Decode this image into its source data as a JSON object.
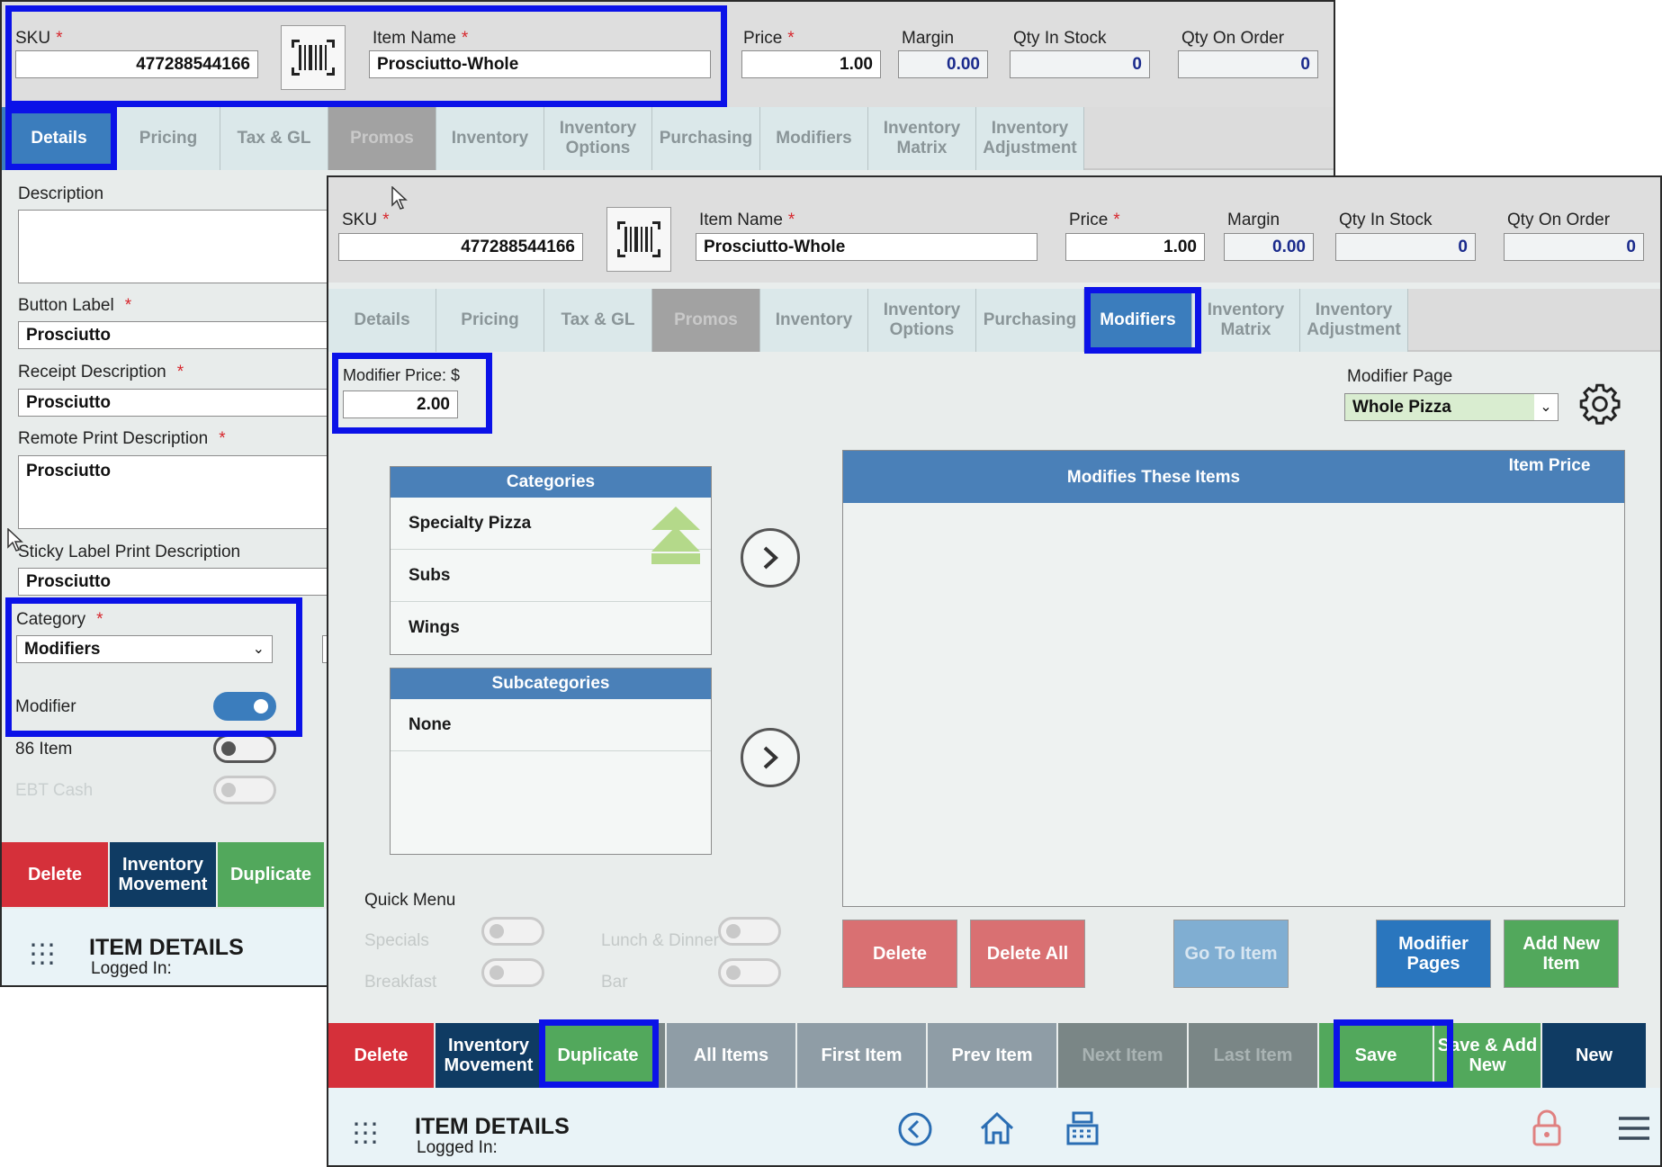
{
  "fields": {
    "sku_label": "SKU",
    "sku_value": "477288544166",
    "item_name_label": "Item Name",
    "item_name_value": "Prosciutto-Whole",
    "price_label": "Price",
    "price_value": "1.00",
    "margin_label": "Margin",
    "margin_value": "0.00",
    "qty_in_stock_label": "Qty In Stock",
    "qty_in_stock_value": "0",
    "qty_on_order_label": "Qty On Order",
    "qty_on_order_value": "0",
    "required_mark": "*"
  },
  "tabs": [
    {
      "label": "Details"
    },
    {
      "label": "Pricing"
    },
    {
      "label": "Tax & GL"
    },
    {
      "label": "Promos"
    },
    {
      "label": "Inventory"
    },
    {
      "label": "Inventory Options"
    },
    {
      "label": "Purchasing"
    },
    {
      "label": "Modifiers"
    },
    {
      "label": "Inventory Matrix"
    },
    {
      "label": "Inventory Adjustment"
    }
  ],
  "details": {
    "description_label": "Description",
    "description_value": "",
    "button_label_label": "Button Label",
    "button_label_value": "Prosciutto",
    "receipt_label": "Receipt Description",
    "receipt_value": "Prosciutto",
    "remote_label": "Remote Print Description",
    "remote_value": "Prosciutto",
    "sticky_label": "Sticky Label Print Description",
    "sticky_value": "Prosciutto",
    "category_label": "Category",
    "category_value": "Modifiers",
    "modifier_label": "Modifier",
    "item86_label": "86 Item",
    "ebt_label": "EBT Cash"
  },
  "back_buttons": {
    "delete": "Delete",
    "inventory_movement": "Inventory Movement",
    "duplicate": "Duplicate"
  },
  "footer": {
    "title": "ITEM DETAILS",
    "logged_in": "Logged In:"
  },
  "modifiers": {
    "modifier_price_label": "Modifier Price: $",
    "modifier_price_value": "2.00",
    "modifier_page_label": "Modifier Page",
    "modifier_page_value": "Whole Pizza",
    "categories_header": "Categories",
    "categories": [
      "Specialty Pizza",
      "Subs",
      "Wings"
    ],
    "subcategories_header": "Subcategories",
    "subcategories": [
      "None"
    ],
    "table_header": "Modifies These Items",
    "item_price_header": "Item Price",
    "quick_menu_label": "Quick Menu",
    "quick_menu": [
      "Specials",
      "Lunch & Dinner",
      "Breakfast",
      "Bar"
    ],
    "actions": {
      "delete": "Delete",
      "delete_all": "Delete All",
      "go_to_item": "Go To Item",
      "modifier_pages": "Modifier Pages",
      "add_new_item": "Add New Item"
    }
  },
  "front_buttons": {
    "delete": "Delete",
    "inventory_movement": "Inventory Movement",
    "duplicate": "Duplicate",
    "all_items": "All Items",
    "first_item": "First Item",
    "prev_item": "Prev Item",
    "next_item": "Next Item",
    "last_item": "Last Item",
    "save": "Save",
    "save_add_new": "Save & Add New",
    "new": "New"
  },
  "colors": {
    "highlight": "#0b12e8",
    "tab_active": "#3b7dbd",
    "delete_red": "#d5303a",
    "navy": "#0f3b63",
    "green": "#52a85c"
  }
}
